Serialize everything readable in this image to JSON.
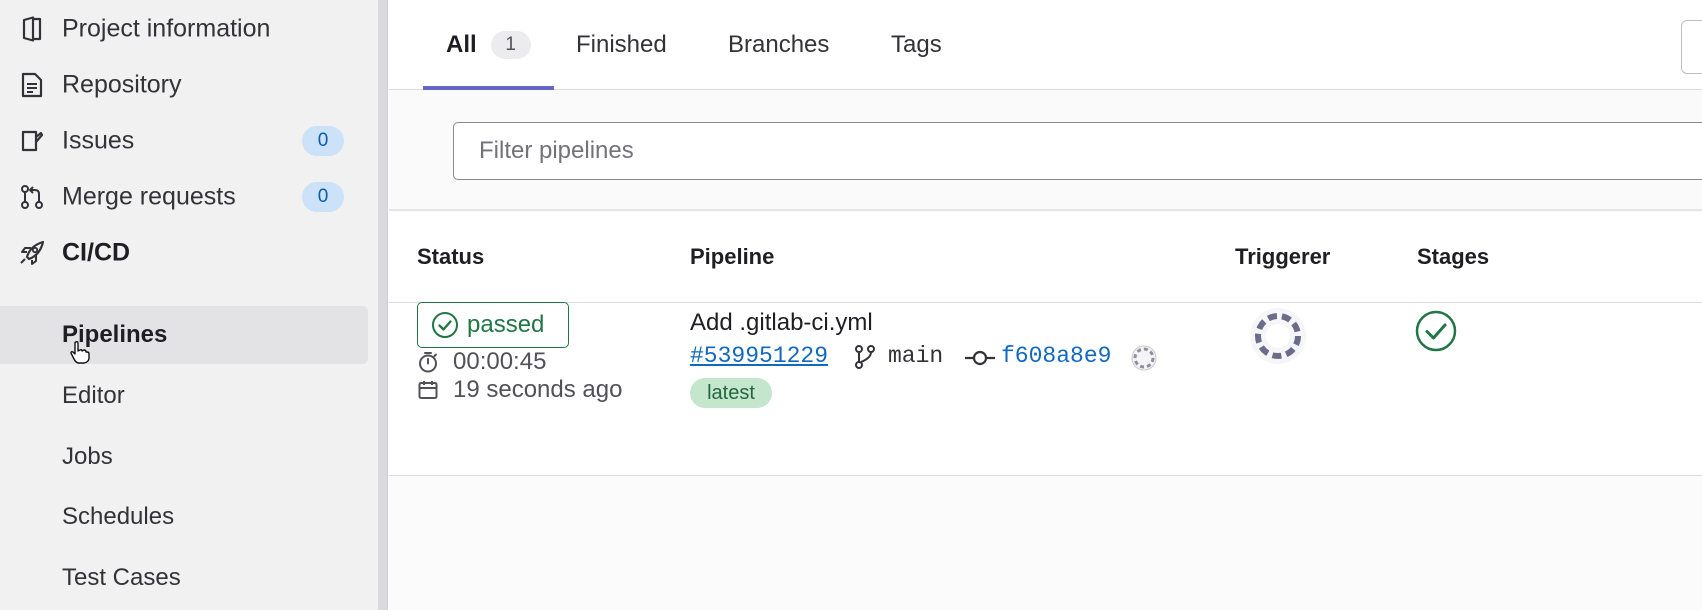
{
  "sidebar": {
    "items": [
      {
        "label": "Project information",
        "icon": "project-icon"
      },
      {
        "label": "Repository",
        "icon": "document-icon"
      },
      {
        "label": "Issues",
        "icon": "issues-icon",
        "badge": "0"
      },
      {
        "label": "Merge requests",
        "icon": "merge-request-icon",
        "badge": "0"
      },
      {
        "label": "CI/CD",
        "icon": "rocket-icon"
      }
    ],
    "subitems": [
      {
        "label": "Pipelines",
        "active": true
      },
      {
        "label": "Editor"
      },
      {
        "label": "Jobs"
      },
      {
        "label": "Schedules"
      },
      {
        "label": "Test Cases"
      }
    ]
  },
  "tabs": [
    {
      "label": "All",
      "count": "1",
      "active": true
    },
    {
      "label": "Finished"
    },
    {
      "label": "Branches"
    },
    {
      "label": "Tags"
    }
  ],
  "filter": {
    "placeholder": "Filter pipelines",
    "value": ""
  },
  "table": {
    "headers": {
      "status": "Status",
      "pipeline": "Pipeline",
      "triggerer": "Triggerer",
      "stages": "Stages"
    },
    "rows": [
      {
        "status": "passed",
        "duration": "00:00:45",
        "finished": "19 seconds ago",
        "title": "Add .gitlab-ci.yml",
        "pipeline_id": "#539951229",
        "branch": "main",
        "commit": "f608a8e9",
        "badge": "latest",
        "stage_status": "success"
      }
    ]
  },
  "colors": {
    "success": "#217645",
    "link": "#1068bf",
    "tab_underline": "#6666c4",
    "badge_blue_bg": "#cbe2f9",
    "latest_bg": "#c3e6cd"
  }
}
